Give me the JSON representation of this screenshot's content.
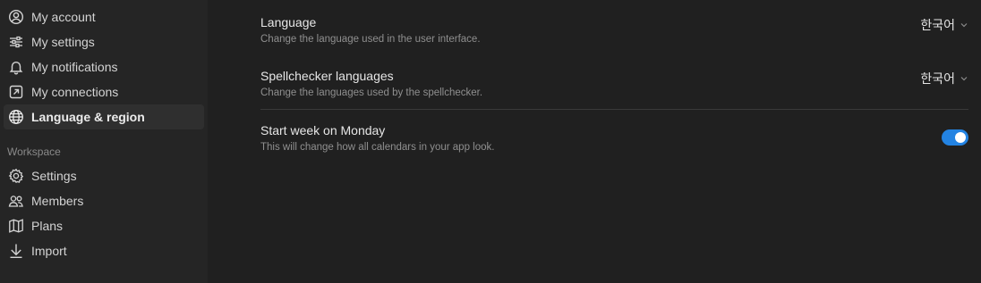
{
  "sidebar": {
    "account_items": [
      {
        "label": "My account",
        "icon": "account-circle-icon"
      },
      {
        "label": "My settings",
        "icon": "sliders-icon"
      },
      {
        "label": "My notifications",
        "icon": "bell-icon"
      },
      {
        "label": "My connections",
        "icon": "external-arrow-icon"
      },
      {
        "label": "Language & region",
        "icon": "globe-icon",
        "active": true
      }
    ],
    "workspace_label": "Workspace",
    "workspace_items": [
      {
        "label": "Settings",
        "icon": "gear-icon"
      },
      {
        "label": "Members",
        "icon": "people-icon"
      },
      {
        "label": "Plans",
        "icon": "map-icon"
      },
      {
        "label": "Import",
        "icon": "download-arrow-icon"
      }
    ]
  },
  "settings": {
    "language": {
      "title": "Language",
      "description": "Change the language used in the user interface.",
      "value": "한국어"
    },
    "spellchecker": {
      "title": "Spellchecker languages",
      "description": "Change the languages used by the spellchecker.",
      "value": "한국어"
    },
    "start_week": {
      "title": "Start week on Monday",
      "description": "This will change how all calendars in your app look.",
      "enabled": true
    }
  },
  "colors": {
    "accent": "#2383e2",
    "background": "#202020",
    "sidebar": "#252525"
  }
}
